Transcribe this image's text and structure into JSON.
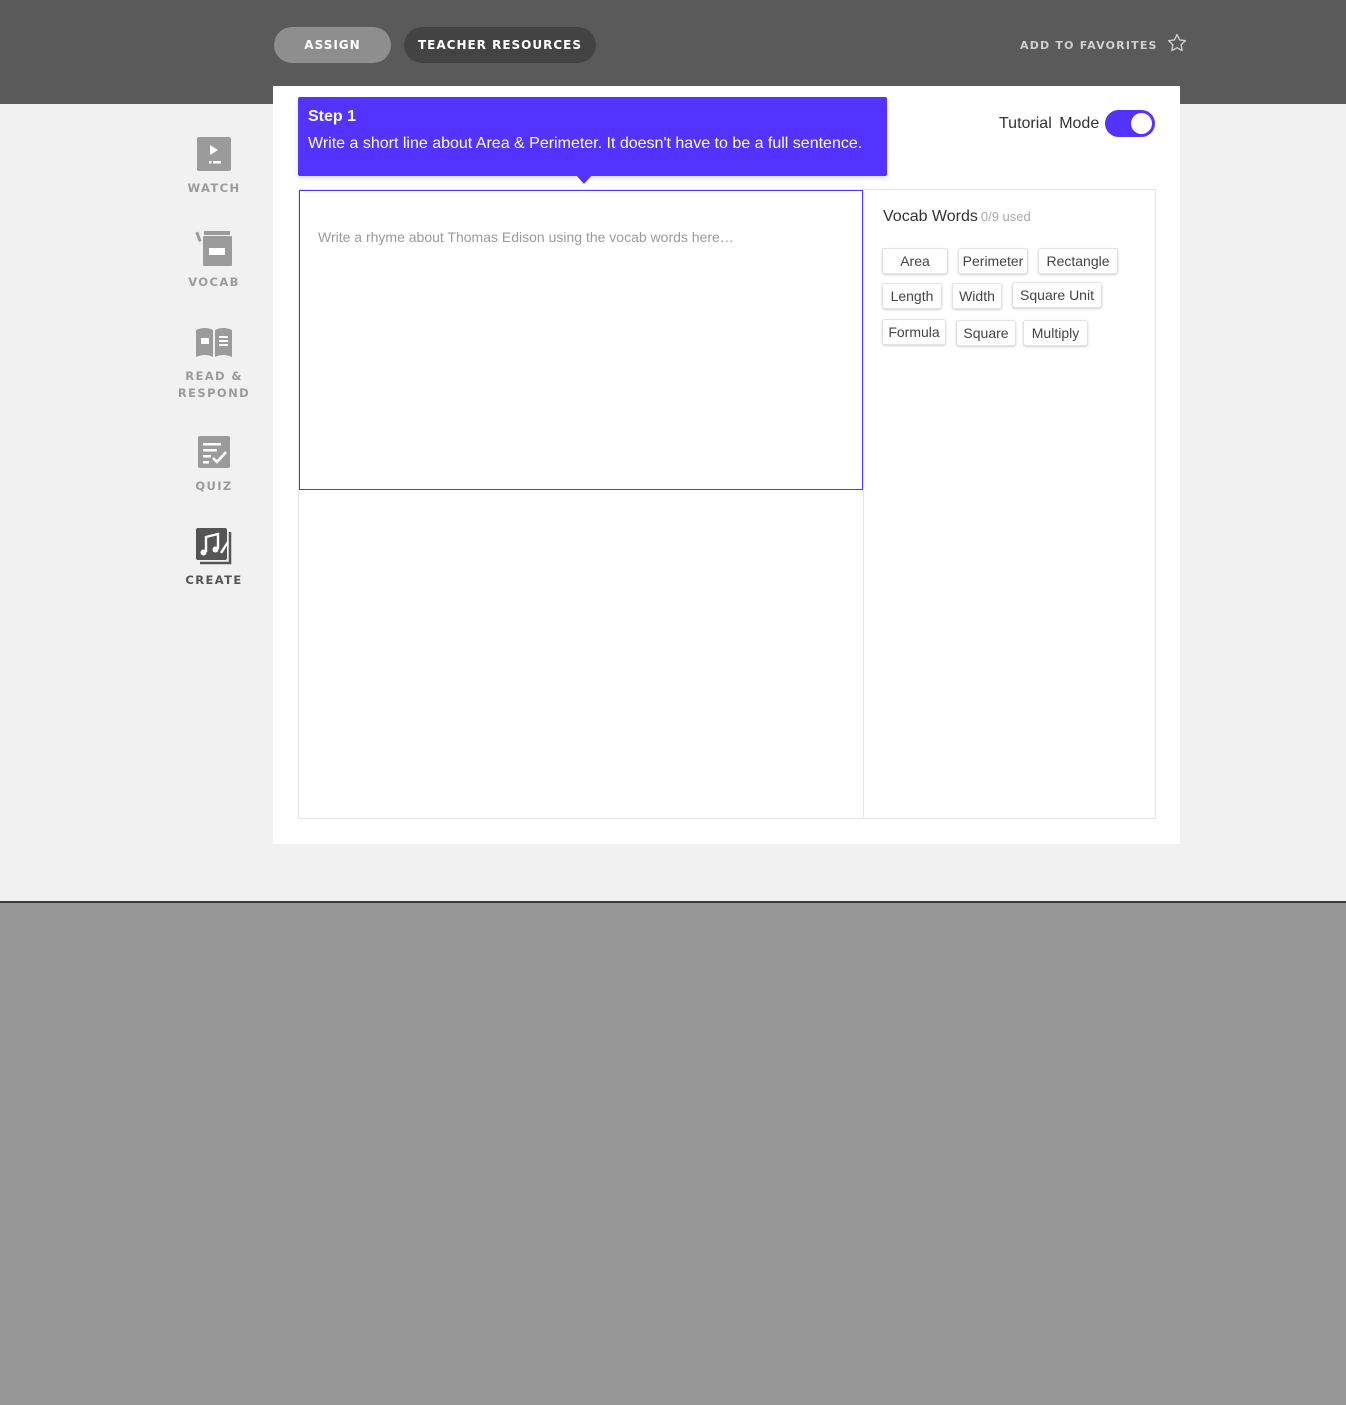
{
  "header": {
    "assign_label": "ASSIGN",
    "teacher_resources_label": "TEACHER RESOURCES",
    "favorites_label": "ADD TO FAVORITES",
    "favorites_icon": "star-outline-icon"
  },
  "sidebar": {
    "items": [
      {
        "label": "WATCH",
        "icon": "video-play-icon"
      },
      {
        "label": "VOCAB",
        "icon": "vocab-cards-icon"
      },
      {
        "label": "READ &",
        "label2": "RESPOND",
        "icon": "open-book-icon"
      },
      {
        "label": "QUIZ",
        "icon": "checklist-icon"
      },
      {
        "label": "CREATE",
        "icon": "music-note-icon",
        "active": true
      }
    ]
  },
  "tutorial": {
    "label": "Tutorial Mode",
    "enabled": true
  },
  "tooltip": {
    "title": "Step 1",
    "body": "Write a short line about Area & Perimeter. It doesn't have to be a full sentence."
  },
  "editor": {
    "placeholder": "Write a rhyme about Thomas Edison using the vocab words here…",
    "value": ""
  },
  "vocab": {
    "title": "Vocab Words",
    "count": "0/9 used",
    "words": [
      "Area",
      "Perimeter",
      "Rectangle",
      "Length",
      "Width",
      "Square Unit",
      "Formula",
      "Square",
      "Multiply"
    ]
  },
  "colors": {
    "accent": "#5233ff",
    "topbar": "#5a5a5a",
    "page_bg": "#f1f1f1",
    "outer_bg": "#979797"
  }
}
